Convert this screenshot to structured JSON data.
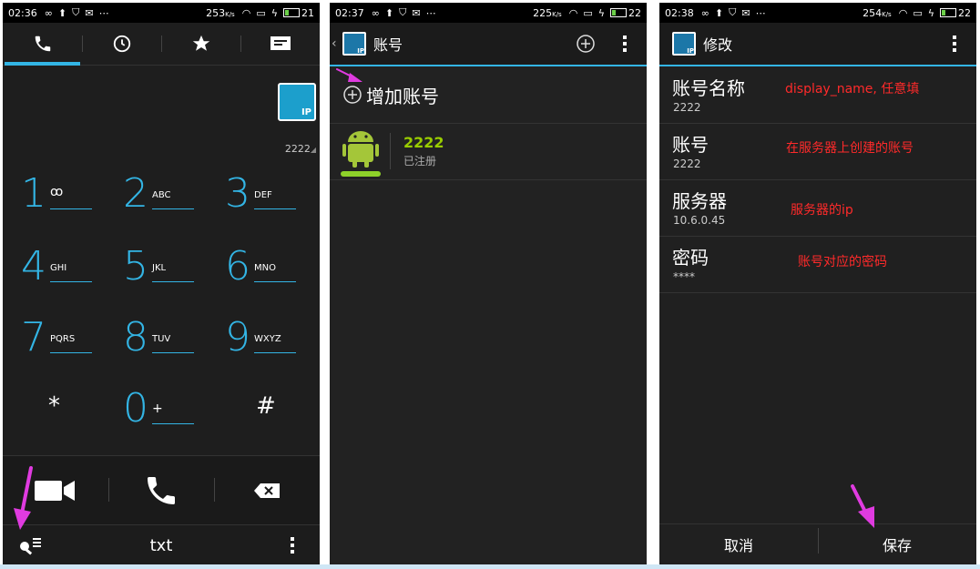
{
  "screen1": {
    "status": {
      "time": "02:36",
      "speed": "253",
      "speed_unit": "K/s",
      "battery": "21"
    },
    "tabs": [
      "phone-icon",
      "clock-icon",
      "star-icon",
      "message-icon"
    ],
    "ip_badge": "IP",
    "account_number": "2222",
    "keys": [
      {
        "num": "1",
        "letters": ""
      },
      {
        "num": "2",
        "letters": "ABC"
      },
      {
        "num": "3",
        "letters": "DEF"
      },
      {
        "num": "4",
        "letters": "GHI"
      },
      {
        "num": "5",
        "letters": "JKL"
      },
      {
        "num": "6",
        "letters": "MNO"
      },
      {
        "num": "7",
        "letters": "PQRS"
      },
      {
        "num": "8",
        "letters": "TUV"
      },
      {
        "num": "9",
        "letters": "WXYZ"
      },
      {
        "num": "*",
        "letters": ""
      },
      {
        "num": "0",
        "letters": "+"
      },
      {
        "num": "#",
        "letters": ""
      }
    ],
    "bottom_text": "txt"
  },
  "screen2": {
    "status": {
      "time": "02:37",
      "speed": "225",
      "speed_unit": "K/s",
      "battery": "22"
    },
    "title": "账号",
    "add_account": "增加账号",
    "account": {
      "name": "2222",
      "status": "已注册"
    }
  },
  "screen3": {
    "status": {
      "time": "02:38",
      "speed": "254",
      "speed_unit": "K/s",
      "battery": "22"
    },
    "title": "修改",
    "fields": [
      {
        "label": "账号名称",
        "value": "2222",
        "note": "display_name, 任意填"
      },
      {
        "label": "账号",
        "value": "2222",
        "note": "在服务器上创建的账号"
      },
      {
        "label": "服务器",
        "value": "10.6.0.45",
        "note": "服务器的ip"
      },
      {
        "label": "密码",
        "value": "****",
        "note": "账号对应的密码"
      }
    ],
    "cancel": "取消",
    "save": "保存"
  },
  "colors": {
    "accent": "#33b5e5",
    "android_green": "#99cc00",
    "annotation": "#ff2a2a",
    "arrow": "#e03be0"
  }
}
